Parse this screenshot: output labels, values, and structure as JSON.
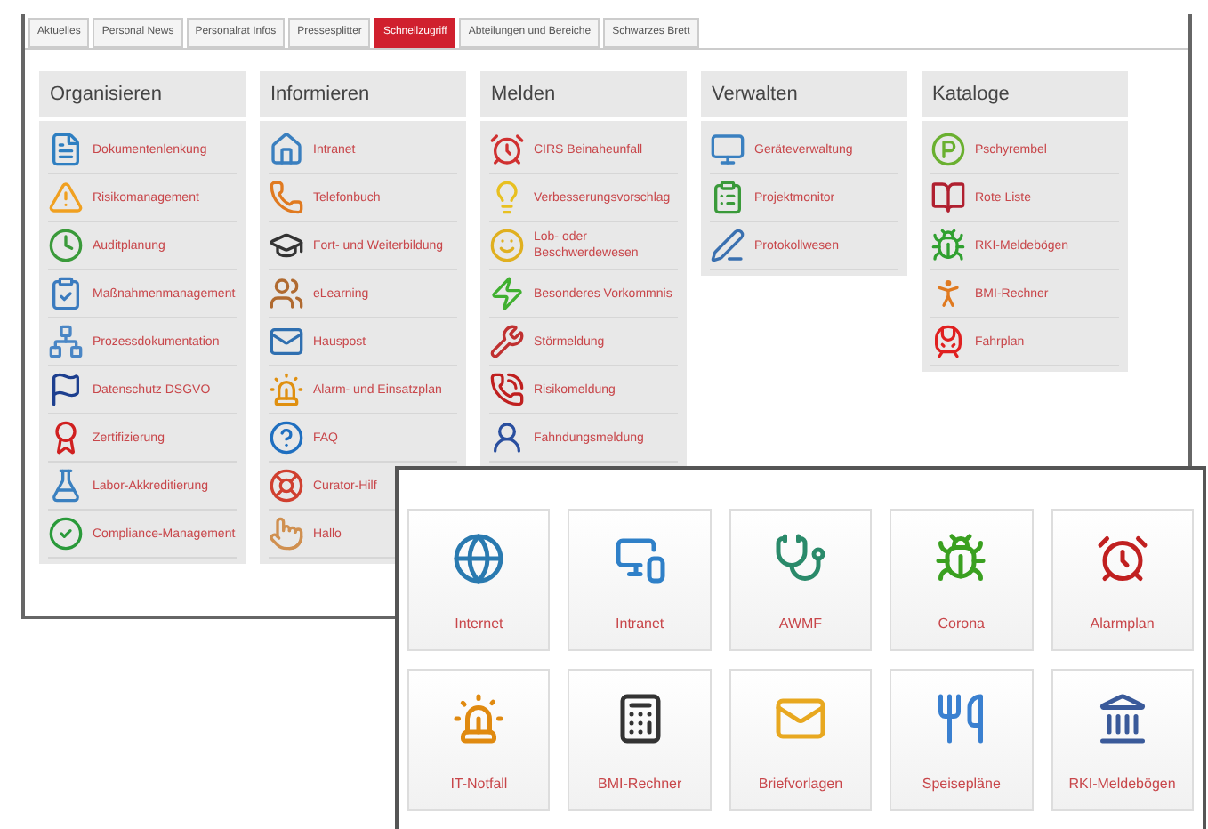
{
  "tabs": [
    {
      "label": "Aktuelles",
      "selected": false
    },
    {
      "label": "Personal News",
      "selected": false
    },
    {
      "label": "Personalrat Infos",
      "selected": false
    },
    {
      "label": "Pressesplitter",
      "selected": false
    },
    {
      "label": "Schnellzugriff",
      "selected": true
    },
    {
      "label": "Abteilungen und Bereiche",
      "selected": false
    },
    {
      "label": "Schwarzes Brett",
      "selected": false
    }
  ],
  "columns": [
    {
      "title": "Organisieren",
      "items": [
        "Dokumentenlenkung",
        "Risikomanagement",
        "Auditplanung",
        "Maßnahmenmanagement",
        "Prozessdokumentation",
        "Datenschutz DSGVO",
        "Zertifizierung",
        "Labor-Akkreditierung",
        "Compliance-Management"
      ]
    },
    {
      "title": "Informieren",
      "items": [
        "Intranet",
        "Telefonbuch",
        "Fort- und Weiterbildung",
        "eLearning",
        "Hauspost",
        "Alarm- und Einsatzplan",
        "FAQ",
        "Curator-Hilf",
        "Hallo"
      ]
    },
    {
      "title": "Melden",
      "items": [
        "CIRS Beinaheunfall",
        "Verbesserungsvorschlag",
        "Lob- oder Beschwerdewesen",
        "Besonderes Vorkommnis",
        "Störmeldung",
        "Risikomeldung",
        "Fahndungsmeldung"
      ]
    },
    {
      "title": "Verwalten",
      "items": [
        "Geräteverwaltung",
        "Projektmonitor",
        "Protokollwesen"
      ]
    },
    {
      "title": "Kataloge",
      "items": [
        "Pschyrembel",
        "Rote Liste",
        "RKI-Meldebögen",
        "BMI-Rechner",
        "Fahrplan"
      ]
    }
  ],
  "tiles": [
    "Internet",
    "Intranet",
    "AWMF",
    "Corona",
    "Alarmplan",
    "IT-Notfall",
    "BMI-Rechner",
    "Briefvorlagen",
    "Speisepläne",
    "RKI-Meldebögen"
  ]
}
